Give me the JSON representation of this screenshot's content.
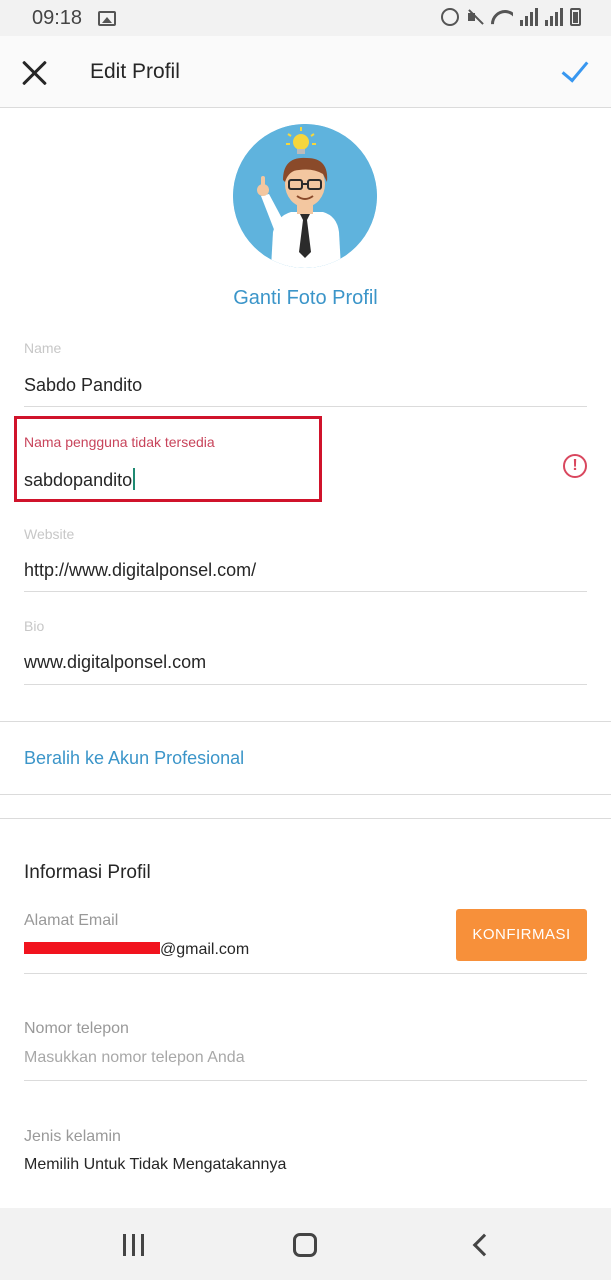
{
  "status_bar": {
    "time": "09:18",
    "icons": [
      "gallery-icon",
      "alarm-icon",
      "mute-icon",
      "wifi-icon",
      "signal-icon",
      "signal-icon",
      "battery-icon"
    ]
  },
  "header": {
    "title": "Edit Profil",
    "close_icon": "close-icon",
    "confirm_icon": "check-icon",
    "accent_color": "#3897f0"
  },
  "profile": {
    "change_photo_label": "Ganti Foto Profil"
  },
  "form": {
    "name": {
      "label": "Name",
      "value": "Sabdo Pandito"
    },
    "username": {
      "error_label": "Nama pengguna tidak tersedia",
      "value": "sabdopandito",
      "status_icon": "error-icon"
    },
    "website": {
      "label": "Website",
      "value": "http://www.digitalponsel.com/"
    },
    "bio": {
      "label": "Bio",
      "value": "www.digitalponsel.com"
    }
  },
  "professional_link": "Beralih ke Akun Profesional",
  "profile_info": {
    "title": "Informasi Profil",
    "email": {
      "label": "Alamat Email",
      "value_suffix": "@gmail.com",
      "confirm_button": "KONFIRMASI"
    },
    "phone": {
      "label": "Nomor telepon",
      "placeholder": "Masukkan nomor telepon Anda"
    },
    "gender": {
      "label": "Jenis kelamin",
      "value": "Memilih Untuk Tidak Mengatakannya"
    }
  },
  "colors": {
    "link": "#3b95c9",
    "error": "#c8445b",
    "confirm_button": "#f7903a",
    "highlight_box": "#d0132b"
  },
  "nav_bar": {
    "icons": [
      "recent-apps-icon",
      "home-icon",
      "back-icon"
    ]
  }
}
